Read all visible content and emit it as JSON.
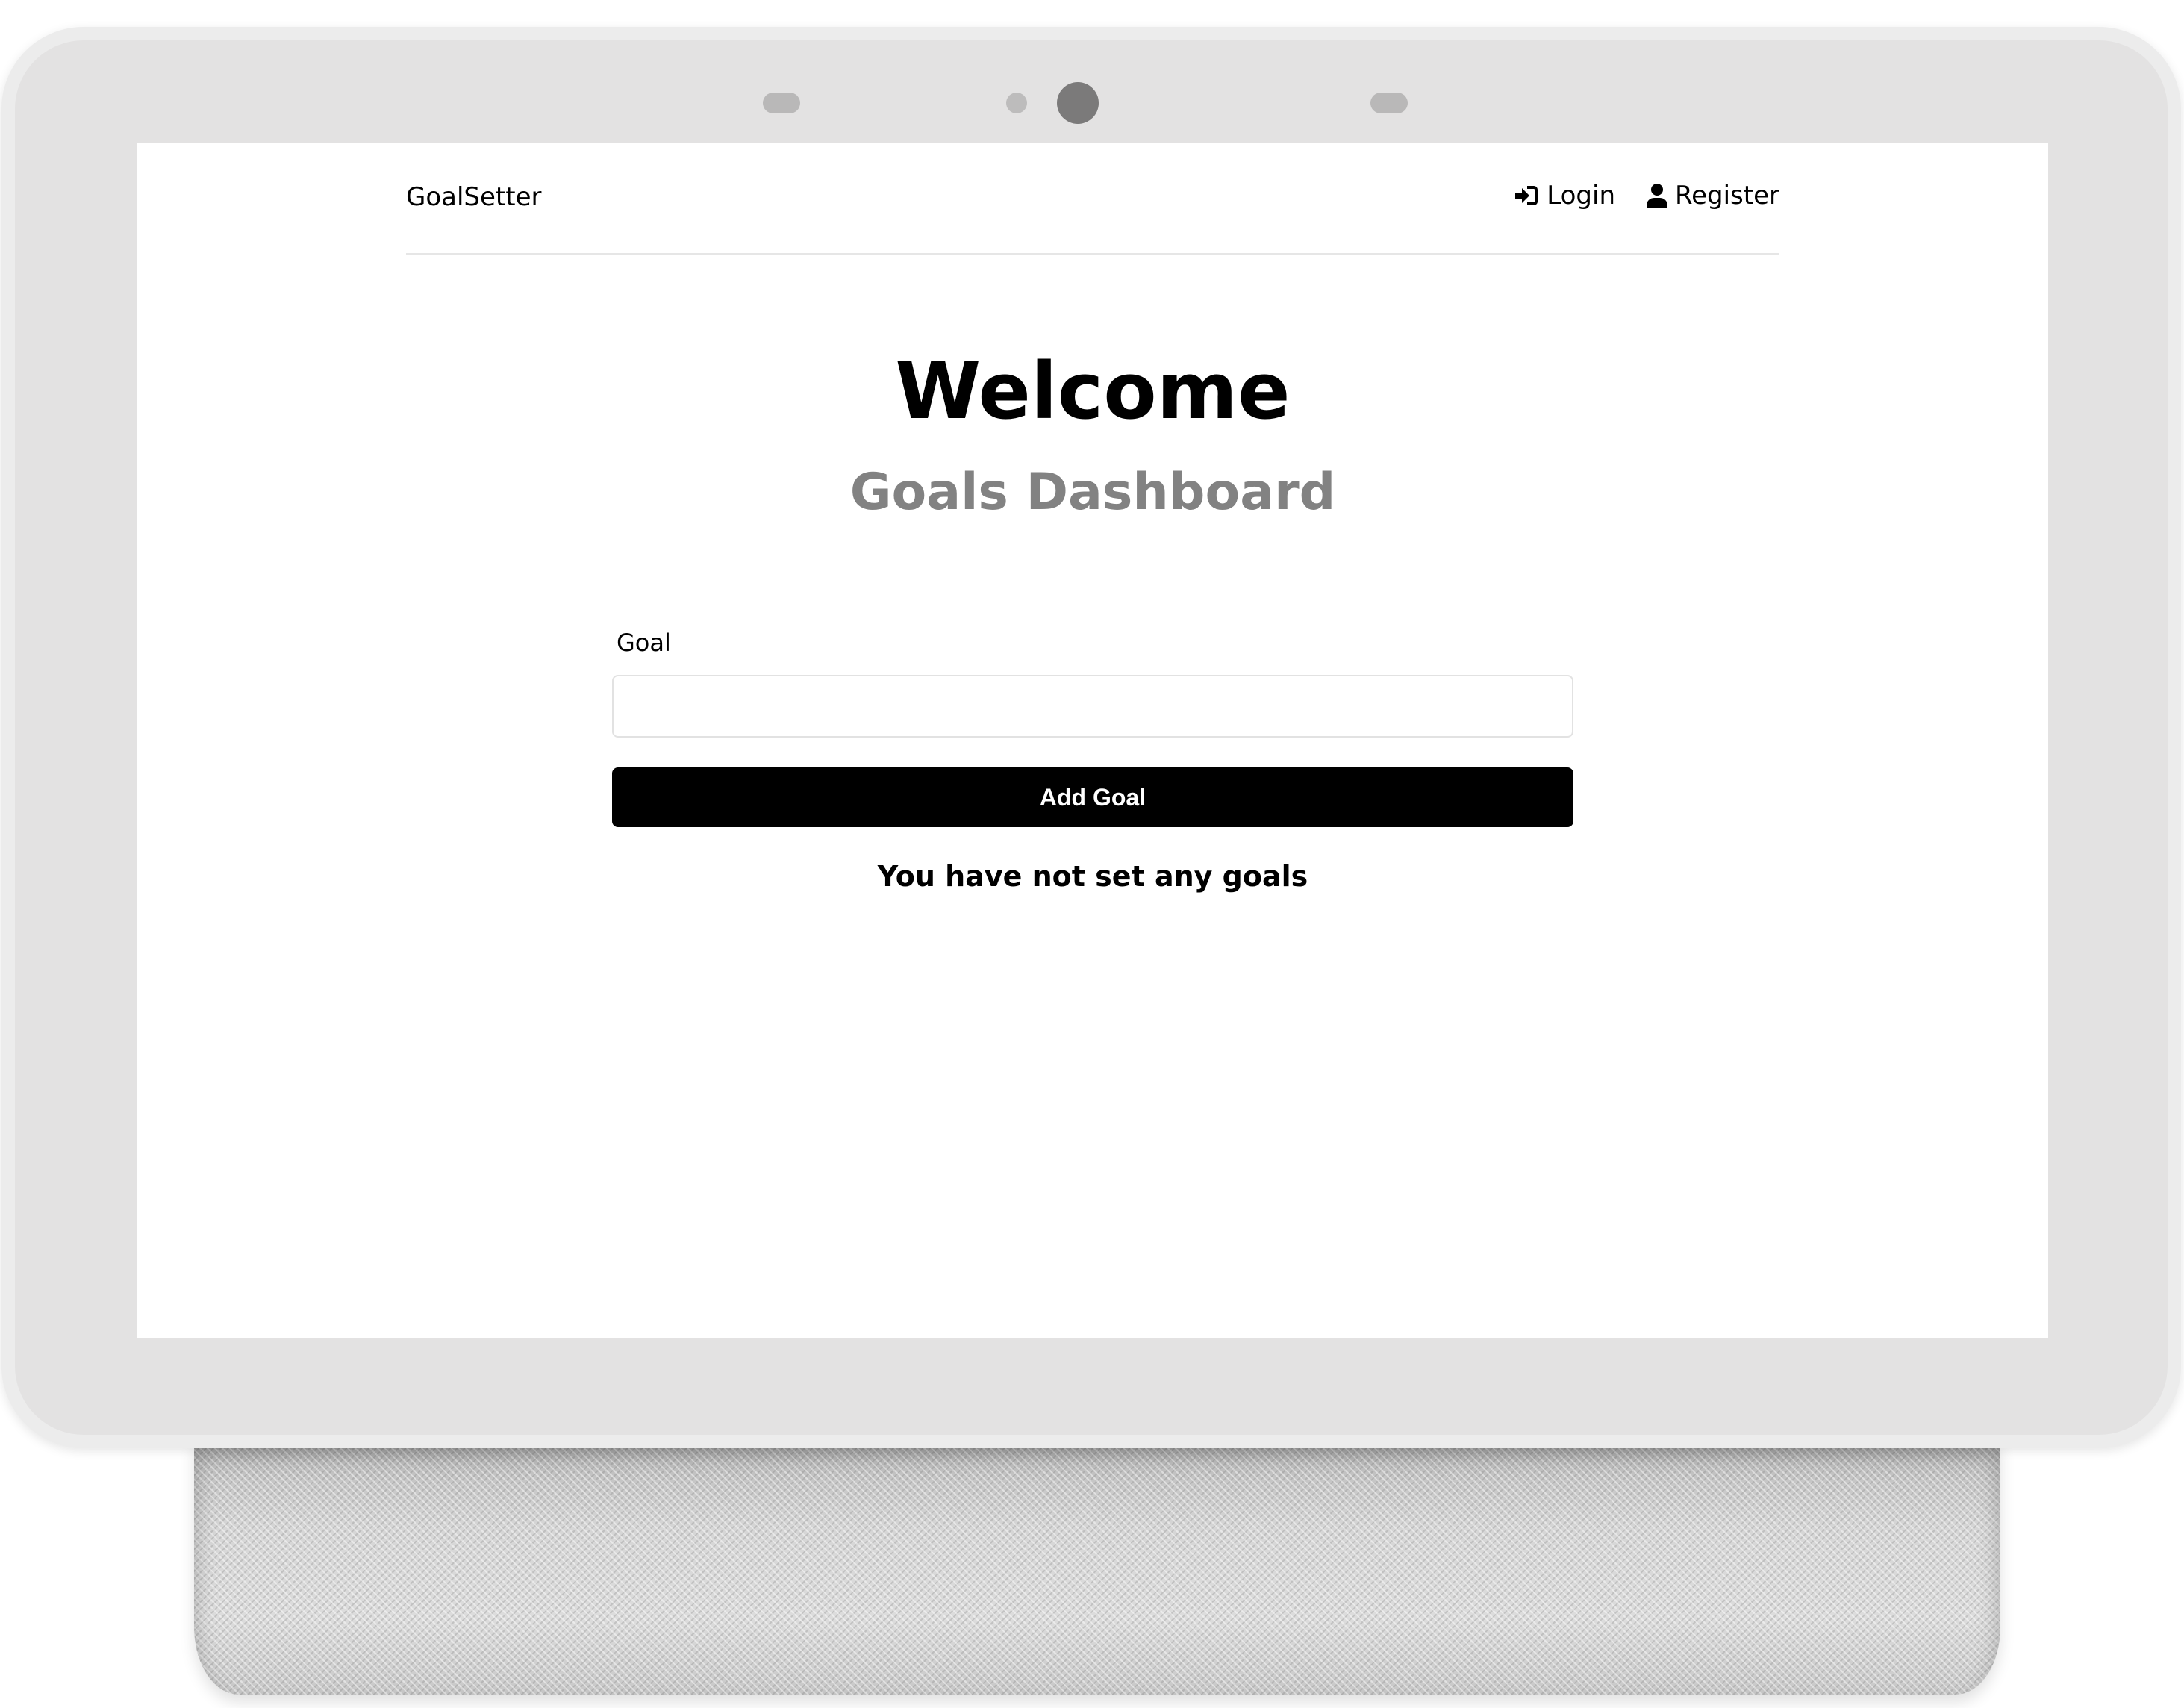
{
  "header": {
    "logo": "GoalSetter",
    "nav": {
      "login_label": "Login",
      "register_label": "Register"
    }
  },
  "hero": {
    "title": "Welcome",
    "subtitle": "Goals Dashboard"
  },
  "goal_form": {
    "label": "Goal",
    "value": "",
    "submit_label": "Add Goal"
  },
  "goals": {
    "empty_message": "You have not set any goals"
  },
  "icons": {
    "login": "sign-in-icon",
    "register": "user-icon"
  },
  "colors": {
    "button_bg": "#000000",
    "button_text": "#ffffff",
    "subtitle": "#828282"
  }
}
